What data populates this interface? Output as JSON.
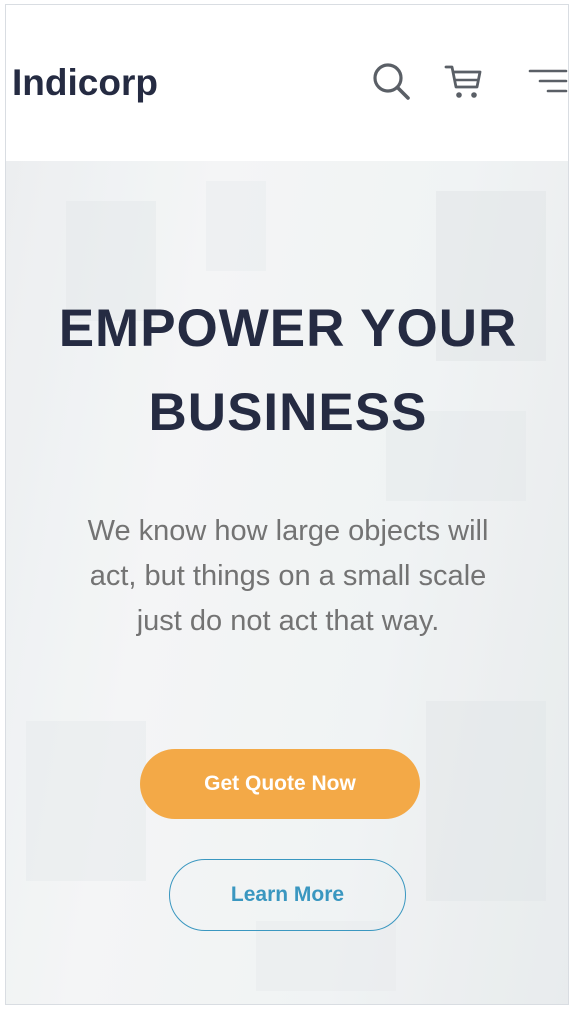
{
  "header": {
    "brand": "Indicorp",
    "icons": [
      "search-icon",
      "cart-icon",
      "menu-icon"
    ]
  },
  "hero": {
    "title_line1": "EMPOWER YOUR",
    "title_line2": "BUSINESS",
    "description": "We know how large objects will act, but things on a small scale just do not act that way.",
    "primary_button": "Get Quote Now",
    "secondary_button": "Learn More"
  },
  "colors": {
    "heading": "#252b42",
    "body_text": "#737373",
    "primary_button": "#f3a947",
    "secondary_button": "#3a97c0"
  }
}
